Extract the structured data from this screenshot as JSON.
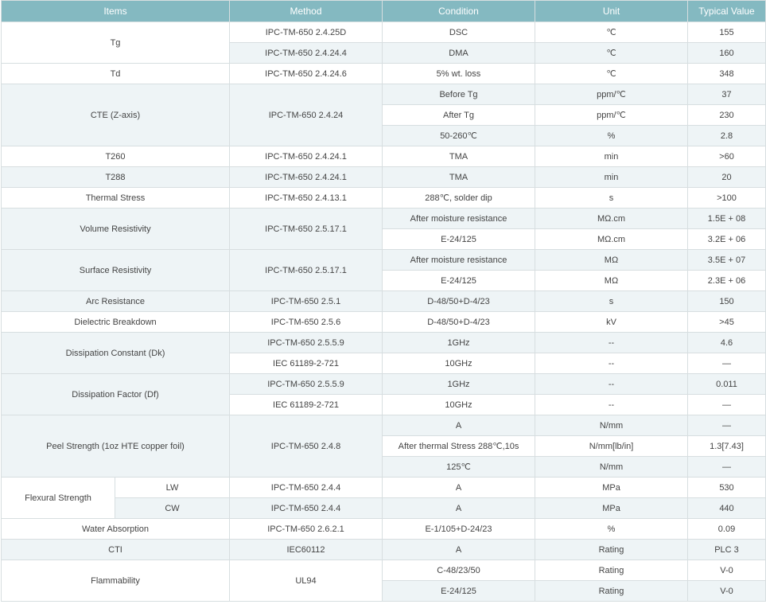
{
  "headers": [
    "Items",
    "Method",
    "Condition",
    "Unit",
    "Typical Value"
  ],
  "rows": [
    {
      "item": "Tg",
      "method": "IPC-TM-650 2.4.25D",
      "condition": "DSC",
      "unit": "℃",
      "value": "155"
    },
    {
      "method": "IPC-TM-650 2.4.24.4",
      "condition": "DMA",
      "unit": "℃",
      "value": "160"
    },
    {
      "item": "Td",
      "method": "IPC-TM-650 2.4.24.6",
      "condition": "5% wt. loss",
      "unit": "℃",
      "value": "348"
    },
    {
      "item": "CTE (Z-axis)",
      "method": "IPC-TM-650 2.4.24",
      "condition": "Before Tg",
      "unit": "ppm/℃",
      "value": "37"
    },
    {
      "condition": "After Tg",
      "unit": "ppm/℃",
      "value": "230"
    },
    {
      "condition": "50-260℃",
      "unit": "%",
      "value": "2.8"
    },
    {
      "item": "T260",
      "method": "IPC-TM-650 2.4.24.1",
      "condition": "TMA",
      "unit": "min",
      "value": ">60"
    },
    {
      "item": "T288",
      "method": "IPC-TM-650 2.4.24.1",
      "condition": "TMA",
      "unit": "min",
      "value": "20"
    },
    {
      "item": "Thermal Stress",
      "method": "IPC-TM-650 2.4.13.1",
      "condition": "288℃, solder dip",
      "unit": "s",
      "value": ">100"
    },
    {
      "item": "Volume Resistivity",
      "method": "IPC-TM-650 2.5.17.1",
      "condition": "After moisture resistance",
      "unit": "MΩ.cm",
      "value": "1.5E + 08"
    },
    {
      "condition": "E-24/125",
      "unit": "MΩ.cm",
      "value": "3.2E + 06"
    },
    {
      "item": "Surface Resistivity",
      "method": "IPC-TM-650 2.5.17.1",
      "condition": "After moisture resistance",
      "unit": "MΩ",
      "value": "3.5E + 07"
    },
    {
      "condition": "E-24/125",
      "unit": "MΩ",
      "value": "2.3E + 06"
    },
    {
      "item": "Arc Resistance",
      "method": "IPC-TM-650 2.5.1",
      "condition": "D-48/50+D-4/23",
      "unit": "s",
      "value": "150"
    },
    {
      "item": "Dielectric Breakdown",
      "method": "IPC-TM-650 2.5.6",
      "condition": "D-48/50+D-4/23",
      "unit": "kV",
      "value": ">45"
    },
    {
      "item": "Dissipation Constant (Dk)",
      "method": "IPC-TM-650 2.5.5.9",
      "condition": "1GHz",
      "unit": "--",
      "value": "4.6"
    },
    {
      "method": "IEC 61189-2-721",
      "condition": "10GHz",
      "unit": "--",
      "value": "—"
    },
    {
      "item": "Dissipation Factor (Df)",
      "method": "IPC-TM-650 2.5.5.9",
      "condition": "1GHz",
      "unit": "--",
      "value": "0.011"
    },
    {
      "method": "IEC 61189-2-721",
      "condition": "10GHz",
      "unit": "--",
      "value": "—"
    },
    {
      "item": "Peel Strength (1oz HTE copper foil)",
      "method": "IPC-TM-650 2.4.8",
      "condition": "A",
      "unit": "N/mm",
      "value": "—"
    },
    {
      "condition": "After thermal Stress 288℃,10s",
      "unit": "N/mm[lb/in]",
      "value": "1.3[7.43]"
    },
    {
      "condition": "125℃",
      "unit": "N/mm",
      "value": "—"
    },
    {
      "item": "Flexural Strength",
      "sub": "LW",
      "method": "IPC-TM-650 2.4.4",
      "condition": "A",
      "unit": "MPa",
      "value": "530"
    },
    {
      "sub": "CW",
      "method": "IPC-TM-650 2.4.4",
      "condition": "A",
      "unit": "MPa",
      "value": "440"
    },
    {
      "item": "Water Absorption",
      "method": "IPC-TM-650 2.6.2.1",
      "condition": "E-1/105+D-24/23",
      "unit": "%",
      "value": "0.09"
    },
    {
      "item": "CTI",
      "method": "IEC60112",
      "condition": "A",
      "unit": "Rating",
      "value": "PLC 3"
    },
    {
      "item": "Flammability",
      "method": "UL94",
      "condition": "C-48/23/50",
      "unit": "Rating",
      "value": "V-0"
    },
    {
      "condition": "E-24/125",
      "unit": "Rating",
      "value": "V-0"
    }
  ]
}
